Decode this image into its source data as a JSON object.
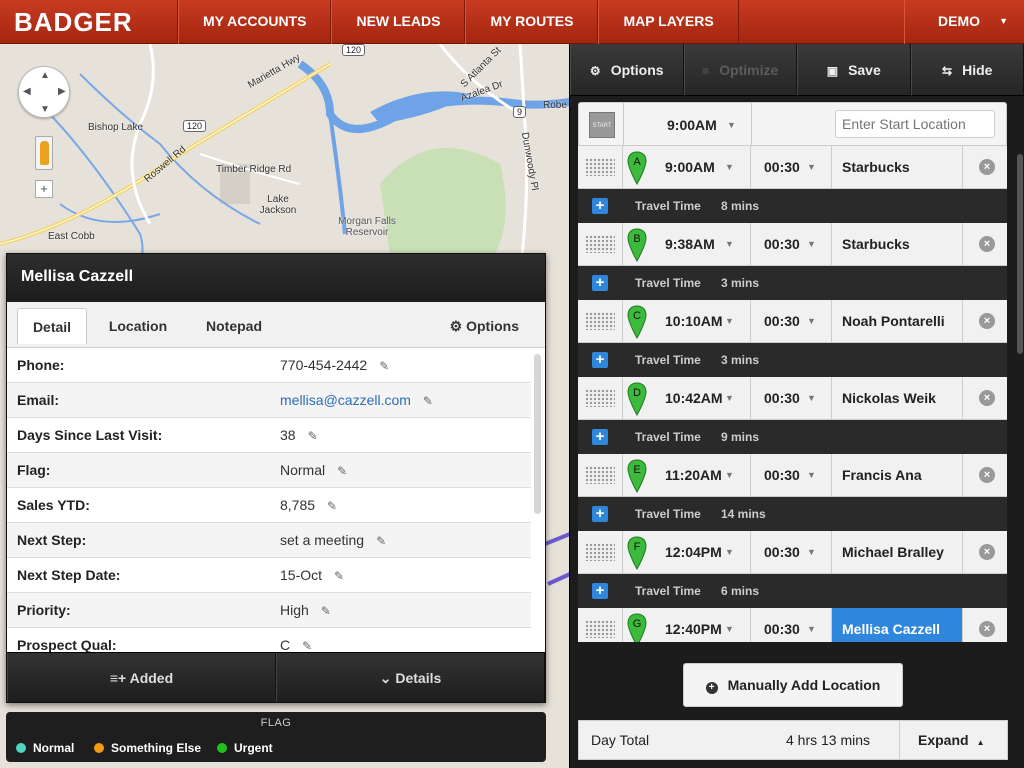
{
  "nav": {
    "brand": "BADGER",
    "items": [
      "MY ACCOUNTS",
      "NEW LEADS",
      "MY ROUTES",
      "MAP LAYERS"
    ],
    "user": "DEMO"
  },
  "map": {
    "labels": [
      "Marietta Hwy",
      "Bishop Lake",
      "Roswell Rd",
      "Timber Ridge Rd",
      "Lake Jackson",
      "East Cobb",
      "Morgan Falls Reservoir",
      "Azalea Dr",
      "Dunwoody Pl",
      "S Atlanta St",
      "Robe"
    ],
    "shields": [
      "120",
      "120",
      "9"
    ]
  },
  "customer": {
    "name": "Mellisa Cazzell",
    "tabs": [
      "Detail",
      "Location",
      "Notepad"
    ],
    "options_label": "Options",
    "fields": [
      {
        "label": "Phone:",
        "value": "770-454-2442",
        "link": false
      },
      {
        "label": "Email:",
        "value": "mellisa@cazzell.com",
        "link": true
      },
      {
        "label": "Days Since Last Visit:",
        "value": "38",
        "link": false
      },
      {
        "label": "Flag:",
        "value": "Normal",
        "link": false
      },
      {
        "label": "Sales YTD:",
        "value": "8,785",
        "link": false
      },
      {
        "label": "Next Step:",
        "value": "set a meeting",
        "link": false
      },
      {
        "label": "Next Step Date:",
        "value": "15-Oct",
        "link": false
      },
      {
        "label": "Priority:",
        "value": "High",
        "link": false
      },
      {
        "label": "Prospect Qual:",
        "value": "C",
        "link": false
      }
    ],
    "footer": {
      "added": "Added",
      "details": "Details"
    }
  },
  "legend": {
    "title": "FLAG",
    "items": [
      {
        "label": "Normal",
        "color": "#4fd6c0"
      },
      {
        "label": "Something Else",
        "color": "#f39b12"
      },
      {
        "label": "Urgent",
        "color": "#1ec21e"
      }
    ]
  },
  "route": {
    "toolbar": {
      "options": "Options",
      "optimize": "Optimize",
      "save": "Save",
      "hide": "Hide"
    },
    "start": {
      "badge": "START",
      "time": "9:00AM",
      "placeholder": "Enter Start Location"
    },
    "stops": [
      {
        "letter": "A",
        "time": "9:00AM",
        "duration": "00:30",
        "name": "Starbucks",
        "selected": false
      },
      {
        "letter": "B",
        "time": "9:38AM",
        "duration": "00:30",
        "name": "Starbucks",
        "selected": false
      },
      {
        "letter": "C",
        "time": "10:10AM",
        "duration": "00:30",
        "name": "Noah Pontarelli",
        "selected": false
      },
      {
        "letter": "D",
        "time": "10:42AM",
        "duration": "00:30",
        "name": "Nickolas Weik",
        "selected": false
      },
      {
        "letter": "E",
        "time": "11:20AM",
        "duration": "00:30",
        "name": "Francis Ana",
        "selected": false
      },
      {
        "letter": "F",
        "time": "12:04PM",
        "duration": "00:30",
        "name": "Michael Bralley",
        "selected": false
      },
      {
        "letter": "G",
        "time": "12:40PM",
        "duration": "00:30",
        "name": "Mellisa Cazzell",
        "selected": true
      }
    ],
    "travel_label": "Travel Time",
    "travel": [
      "8 mins",
      "3 mins",
      "3 mins",
      "9 mins",
      "14 mins",
      "6 mins"
    ],
    "manual_add": "Manually Add Location",
    "day_total_label": "Day Total",
    "day_total_value": "4 hrs 13 mins",
    "expand": "Expand"
  },
  "colors": {
    "brand_red": "#b8301a",
    "selected_blue": "#2f86dd",
    "pin_green": "#3cba3c"
  }
}
